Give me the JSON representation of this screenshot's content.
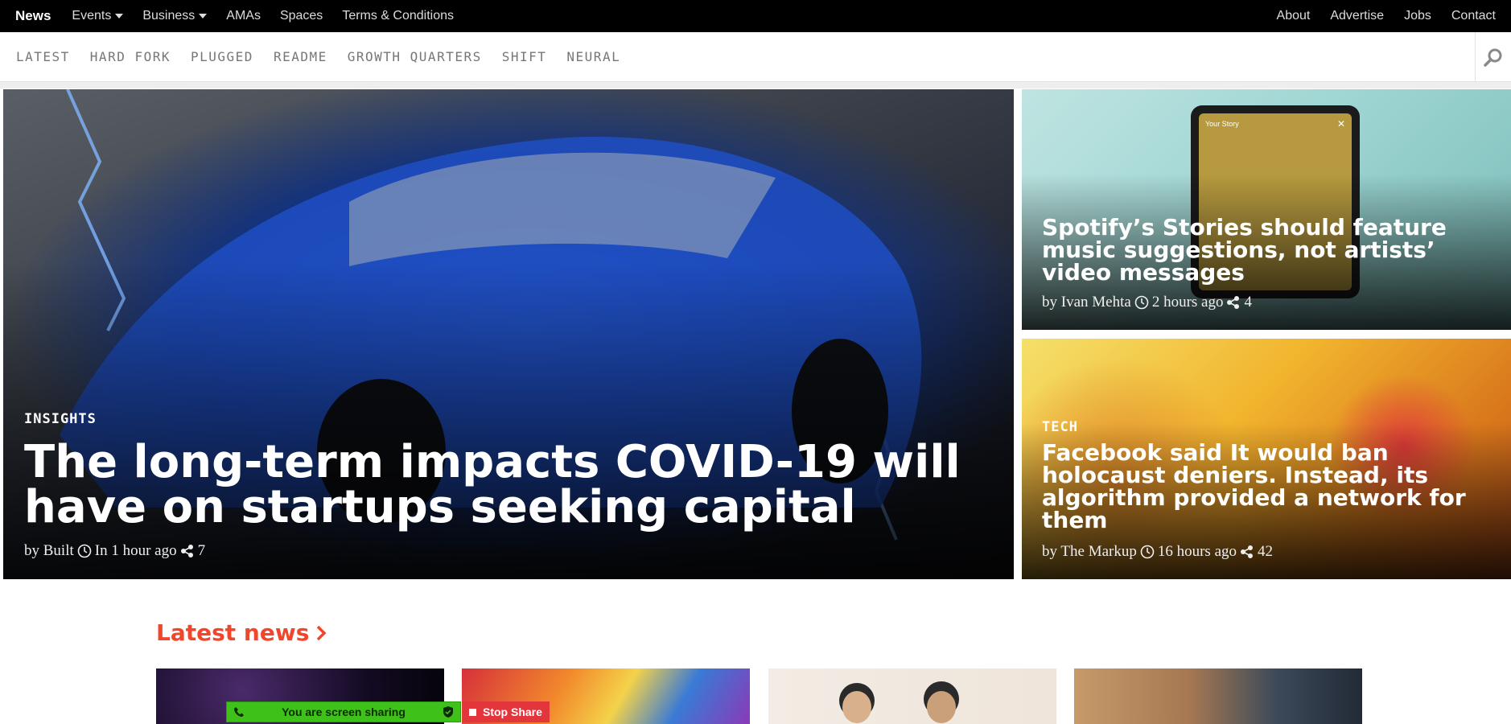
{
  "top_nav": {
    "brand": "News",
    "left_items": [
      {
        "label": "Events",
        "has_dropdown": true
      },
      {
        "label": "Business",
        "has_dropdown": true
      },
      {
        "label": "AMAs",
        "has_dropdown": false
      },
      {
        "label": "Spaces",
        "has_dropdown": false
      },
      {
        "label": "Terms & Conditions",
        "has_dropdown": false
      }
    ],
    "right_items": [
      "About",
      "Advertise",
      "Jobs",
      "Contact"
    ]
  },
  "category_nav": {
    "items": [
      "LATEST",
      "HARD FORK",
      "PLUGGED",
      "README",
      "GROWTH QUARTERS",
      "SHIFT",
      "NEURAL"
    ],
    "search_icon": "search-icon"
  },
  "hero": {
    "main": {
      "tag": "INSIGHTS",
      "title": "The long-term impacts COVID-19 will have on startups seeking capital",
      "author": "by Built",
      "time": "In 1 hour ago",
      "shares": "7"
    },
    "side": [
      {
        "tag": "",
        "title": "Spotify’s Stories should feature music suggestions, not artists’ video messages",
        "author": "by Ivan Mehta",
        "time": "2 hours ago",
        "shares": "4",
        "phone_story_label": "Your Story"
      },
      {
        "tag": "TECH",
        "title": "Facebook said It would ban holocaust deniers. Instead, its algorithm provided a network for them",
        "author": "by The Markup",
        "time": "16 hours ago",
        "shares": "42"
      }
    ]
  },
  "latest": {
    "title": "Latest news"
  },
  "screen_share": {
    "status": "You are screen sharing",
    "stop_label": "Stop Share"
  },
  "colors": {
    "accent": "#f2462c",
    "topbar": "#000000",
    "share_green": "#3ec21a",
    "stop_red": "#e2353c"
  }
}
